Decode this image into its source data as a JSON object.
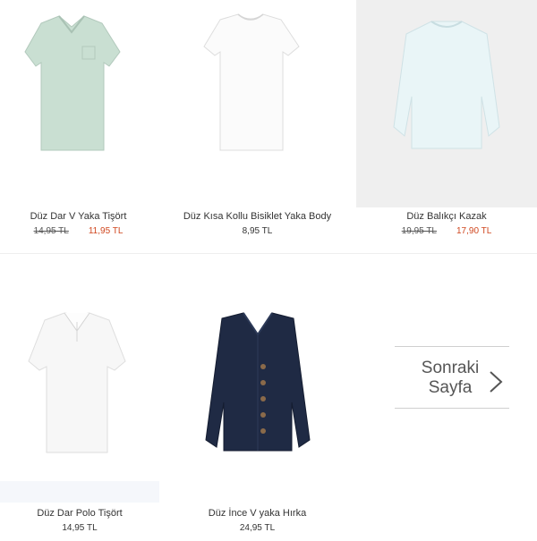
{
  "products": [
    {
      "name": "Düz Dar V Yaka Tişört",
      "old_price": "14,95 TL",
      "price": "11,95 TL",
      "image": "mint-vneck-tshirt"
    },
    {
      "name": "Düz Kısa Kollu Bisiklet Yaka Body",
      "price": "8,95 TL",
      "image": "white-crew-tshirt"
    },
    {
      "name": "Düz Balıkçı Kazak",
      "old_price": "19,95 TL",
      "price": "17,90 TL",
      "image": "pale-blue-sweater"
    },
    {
      "name": "Düz Dar Polo Tişört",
      "price": "14,95 TL",
      "image": "white-polo-shirt"
    },
    {
      "name": "Düz İnce V yaka Hırka",
      "price": "24,95 TL",
      "image": "navy-cardigan"
    }
  ],
  "pagination": {
    "next_line1": "Sonraki",
    "next_line2": "Sayfa",
    "icon": "chevron-right-icon"
  },
  "colors": {
    "sale_price": "#d0471f",
    "text": "#333333"
  }
}
